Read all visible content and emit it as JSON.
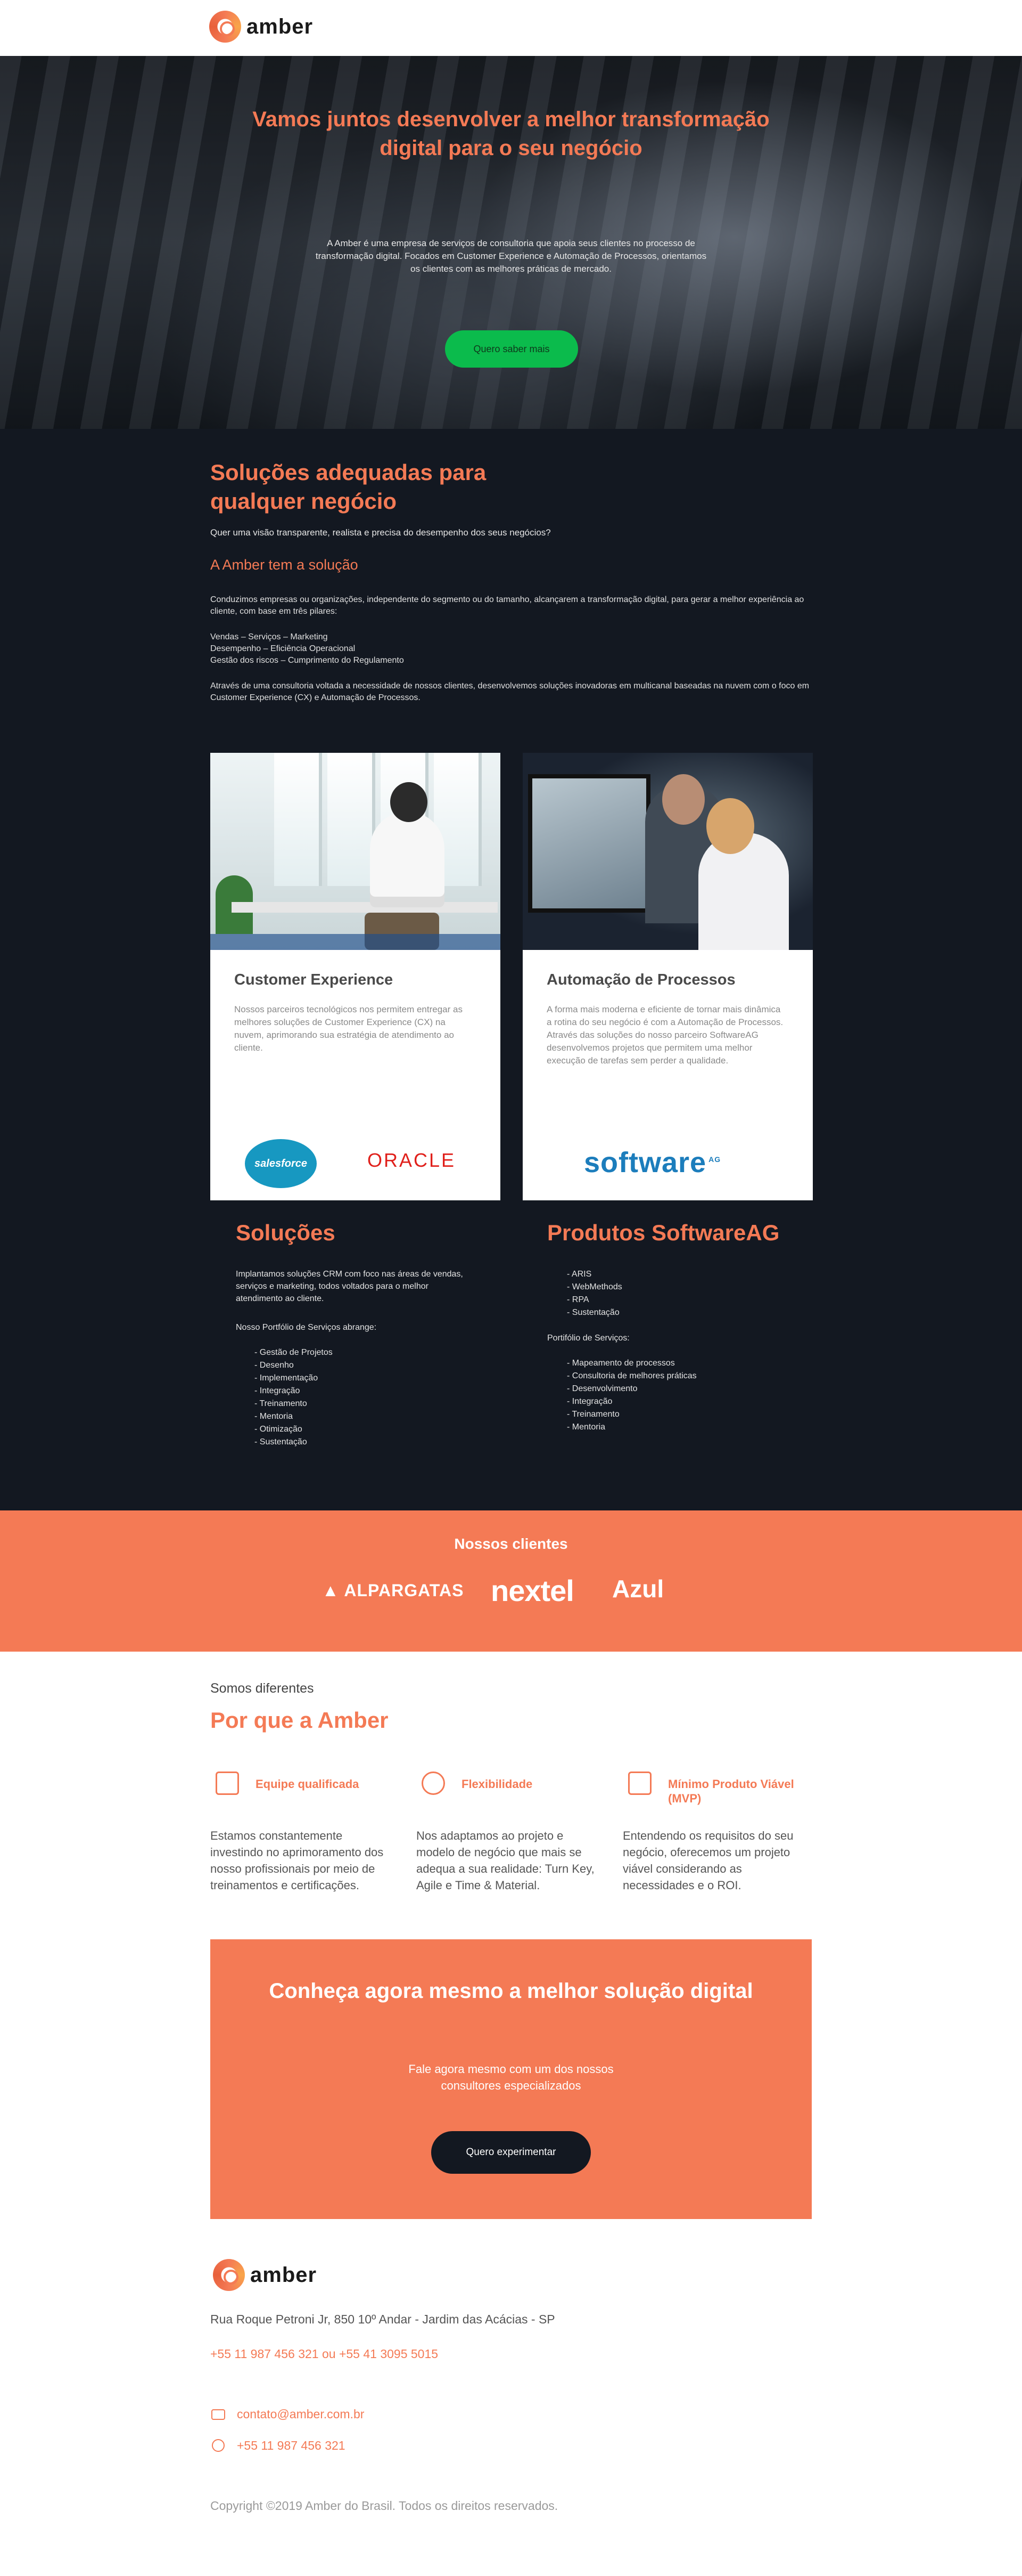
{
  "header": {
    "logo_text": "amber"
  },
  "hero": {
    "title": "Vamos juntos desenvolver a melhor transformação digital para o seu negócio",
    "description": "A Amber é uma empresa de serviços de consultoria que apoia seus clientes no processo de transformação digital. Focados em Customer Experience e Automação de Processos, orientamos os clientes com as melhores práticas de mercado.",
    "cta_label": "Quero saber mais"
  },
  "solutions": {
    "title": "Soluções  adequadas para qualquer negócio",
    "question": "Quer uma visão transparente, realista e precisa do desempenho dos seus negócios?",
    "subtitle": "A Amber tem a solução",
    "intro": "Conduzimos empresas ou organizações, independente do segmento ou do tamanho, alcançarem a transformação digital, para gerar a melhor experiência ao cliente, com base em três pilares:",
    "pillars": [
      "Vendas – Serviços – Marketing",
      "Desempenho – Eficiência Operacional",
      "Gestão dos riscos – Cumprimento do Regulamento"
    ],
    "closing": "Através de uma consultoria voltada a necessidade de nossos clientes, desenvolvemos soluções inovadoras em multicanal baseadas na nuvem com o foco em Customer Experience (CX) e Automação de Processos."
  },
  "cards": [
    {
      "title": "Customer Experience",
      "description": "Nossos parceiros tecnológicos nos permitem entregar as melhores soluções de Customer Experience (CX) na nuvem, aprimorando sua estratégia de atendimento ao cliente.",
      "brands": [
        "salesforce",
        "ORACLE"
      ]
    },
    {
      "title": "Automação de Processos",
      "description": "A forma mais moderna e eficiente de tornar mais dinâmica a rotina do seu negócio é com a Automação de Processos. Através das soluções do nosso parceiro SoftwareAG desenvolvemos projetos que permitem uma melhor execução de tarefas sem perder a qualidade.",
      "brands": [
        "software",
        "AG"
      ]
    }
  ],
  "solucoes": {
    "title": "Soluções",
    "text": "Implantamos soluções CRM com foco nas áreas de vendas, serviços e marketing, todos voltados para o melhor atendimento ao cliente.",
    "portfolio_label": "Nosso Portfólio de Serviços abrange:",
    "items": [
      "- Gestão de Projetos",
      "- Desenho",
      "- Implementação",
      "- Integração",
      "- Treinamento",
      "- Mentoria",
      "- Otimização",
      "- Sustentação"
    ]
  },
  "produtos": {
    "title": "Produtos SoftwareAG",
    "items": [
      "- ARIS",
      "- WebMethods",
      "- RPA",
      "- Sustentação"
    ],
    "portfolio_label": "Portifólio de Serviços:",
    "services": [
      "- Mapeamento de processos",
      "- Consultoria de melhores práticas",
      "- Desenvolvimento",
      "- Integração",
      "- Treinamento",
      "- Mentoria"
    ]
  },
  "clients": {
    "title": "Nossos clientes",
    "logos": [
      "ALPARGATAS",
      "nextel",
      "Azul"
    ]
  },
  "why": {
    "kicker": "Somos diferentes",
    "title": "Por que a Amber",
    "features": [
      {
        "icon": "certificate-icon",
        "title": "Equipe qualificada",
        "description": "Estamos constantemente investindo no aprimoramento dos nosso profissionais por meio de treinamentos e certificações."
      },
      {
        "icon": "hierarchy-icon",
        "title": "Flexibilidade",
        "description": "Nos adaptamos ao projeto e modelo de negócio que mais se adequa a sua realidade: Turn Key, Agile e Time & Material."
      },
      {
        "icon": "document-icon",
        "title": "Mínimo Produto Viável (MVP)",
        "description": "Entendendo os requisitos do seu negócio, oferecemos um projeto viável considerando as necessidades e o ROI."
      }
    ]
  },
  "cta": {
    "title": "Conheça agora mesmo a melhor solução digital",
    "text": "Fale agora mesmo com um dos  nossos consultores especializados",
    "button": "Quero experimentar"
  },
  "footer": {
    "logo_text": "amber",
    "address": "Rua Roque Petroni Jr, 850 10º Andar - Jardim das Acácias - SP",
    "phones": "+55 11 987 456 321 ou +55 41 3095 5015",
    "email": "contato@amber.com.br",
    "whatsapp": "+55 11 987 456 321",
    "copyright": "Copyright ©2019 Amber do Brasil. Todos os direitos reservados."
  },
  "colors": {
    "accent": "#f47a55",
    "dark": "#131821",
    "green": "#0bbb4c"
  }
}
